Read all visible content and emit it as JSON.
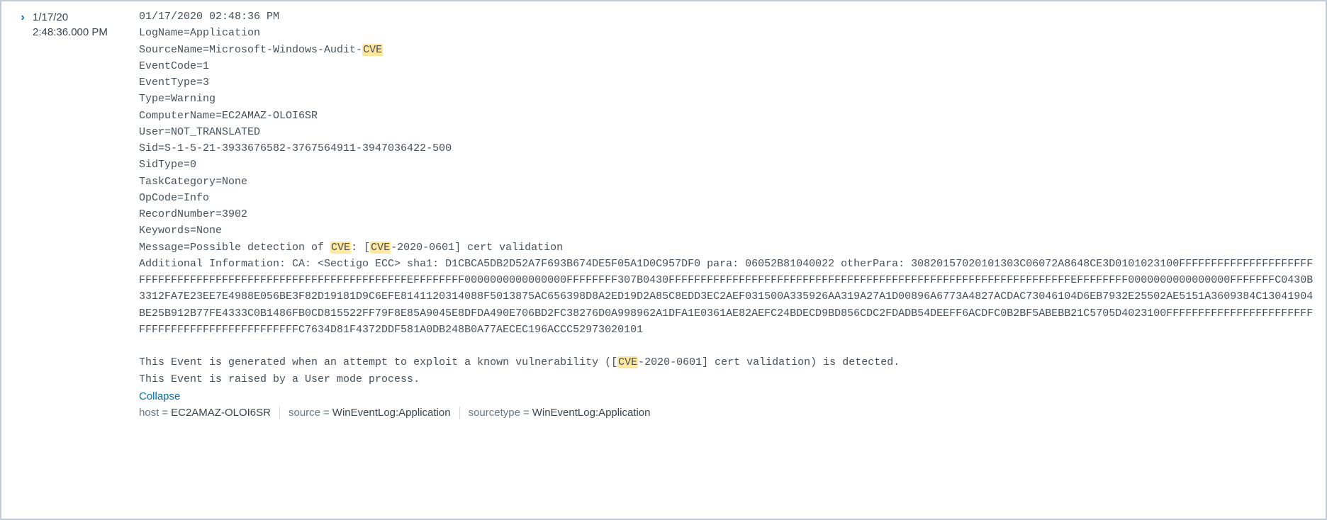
{
  "event": {
    "date": "1/17/20",
    "time": "2:48:36.000 PM",
    "collapse_label": "Collapse",
    "highlight_term": "CVE",
    "raw_segments": [
      {
        "t": "text",
        "v": "01/17/2020 02:48:36 PM\n"
      },
      {
        "t": "text",
        "v": "LogName=Application\n"
      },
      {
        "t": "text",
        "v": "SourceName=Microsoft-Windows-Audit-"
      },
      {
        "t": "hl",
        "v": "CVE"
      },
      {
        "t": "text",
        "v": "\n"
      },
      {
        "t": "text",
        "v": "EventCode=1\n"
      },
      {
        "t": "text",
        "v": "EventType=3\n"
      },
      {
        "t": "text",
        "v": "Type=Warning\n"
      },
      {
        "t": "text",
        "v": "ComputerName=EC2AMAZ-OLOI6SR\n"
      },
      {
        "t": "text",
        "v": "User=NOT_TRANSLATED\n"
      },
      {
        "t": "text",
        "v": "Sid=S-1-5-21-3933676582-3767564911-3947036422-500\n"
      },
      {
        "t": "text",
        "v": "SidType=0\n"
      },
      {
        "t": "text",
        "v": "TaskCategory=None\n"
      },
      {
        "t": "text",
        "v": "OpCode=Info\n"
      },
      {
        "t": "text",
        "v": "RecordNumber=3902\n"
      },
      {
        "t": "text",
        "v": "Keywords=None\n"
      },
      {
        "t": "text",
        "v": "Message=Possible detection of "
      },
      {
        "t": "hl",
        "v": "CVE"
      },
      {
        "t": "text",
        "v": ": ["
      },
      {
        "t": "hl",
        "v": "CVE"
      },
      {
        "t": "text",
        "v": "-2020-0601] cert validation\n"
      },
      {
        "t": "text",
        "v": "Additional Information: CA: <Sectigo ECC> sha1: D1CBCA5DB2D52A7F693B674DE5F05A1D0C957DF0 para: 06052B81040022 otherPara: 30820157020101303C06072A8648CE3D0101023100FFFFFFFFFFFFFFFFFFFFFFFFFFFFFFFFFFFFFFFFFFFFFFFFFFFFFFFFFFFFFFFEFFFFFFFF0000000000000000FFFFFFFF307B0430FFFFFFFFFFFFFFFFFFFFFFFFFFFFFFFFFFFFFFFFFFFFFFFFFFFFFFFFFFFFFFFEFFFFFFFF0000000000000000FFFFFFFC0430B3312FA7E23EE7E4988E056BE3F82D19181D9C6EFE8141120314088F5013875AC656398D8A2ED19D2A85C8EDD3EC2AEF031500A335926AA319A27A1D00896A6773A4827ACDAC73046104D6EB7932E25502AE5151A3609384C13041904BE25B912B77FE4333C0B1486FB0CD815522FF79F8E85A9045E8DFDA490E706BD2FC38276D0A998962A1DFA1E0361AE82AEFC24BDECD9BD856CDC2FDADB54DEEFF6ACDFC0B2BF5ABEBB21C5705D4023100FFFFFFFFFFFFFFFFFFFFFFFFFFFFFFFFFFFFFFFFFFFFFFFFC7634D81F4372DDF581A0DB248B0A77AECEC196ACCC52973020101\n"
      },
      {
        "t": "text",
        "v": "\n"
      },
      {
        "t": "text",
        "v": "This Event is generated when an attempt to exploit a known vulnerability (["
      },
      {
        "t": "hl",
        "v": "CVE"
      },
      {
        "t": "text",
        "v": "-2020-0601] cert validation) is detected.\n"
      },
      {
        "t": "text",
        "v": "This Event is raised by a User mode process."
      }
    ],
    "meta": [
      {
        "key": "host",
        "value": "EC2AMAZ-OLOI6SR"
      },
      {
        "key": "source",
        "value": "WinEventLog:Application"
      },
      {
        "key": "sourcetype",
        "value": "WinEventLog:Application"
      }
    ]
  }
}
